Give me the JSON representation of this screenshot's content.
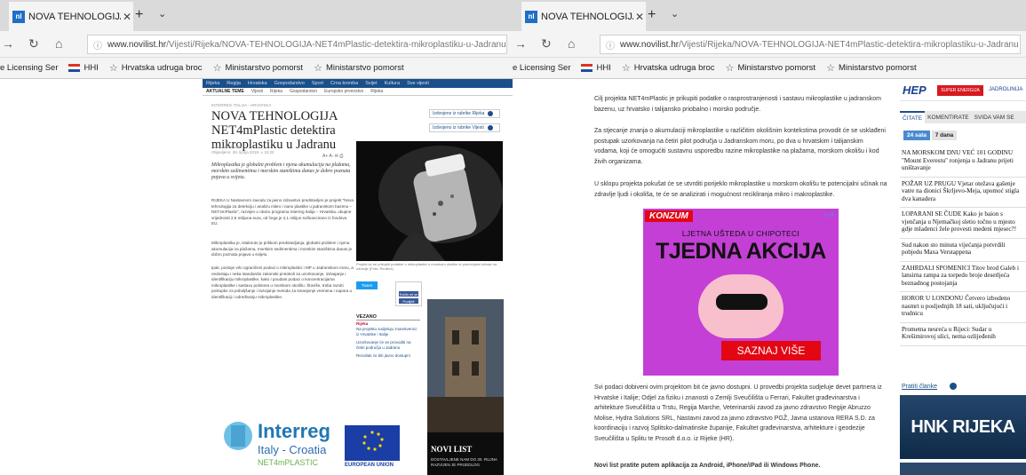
{
  "colors": {
    "brand": "#1b4f8a",
    "ad_bg": "#c43fd6",
    "ad_cta": "#e30613",
    "hep_red": "#d71920"
  },
  "left": {
    "tab_title": "NOVA TEHNOLOGIJA N",
    "url_host": "www.novilist.hr",
    "url_path": "/Vijesti/Rijeka/NOVA-TEHNOLOGIJA-NET4mPlastic-detektira-mikroplastiku-u-Jadranu",
    "bookmarks": [
      "e Licensing Ser",
      "HHI",
      "Hrvatska udruga broc",
      "Ministarstvo pomorst",
      "Ministarstvo pomorst"
    ],
    "page": {
      "nav": [
        "Rijeka",
        "Regija",
        "Hrvatska",
        "Gospodarstvo",
        "Sport",
        "Crna kronika",
        "Svijet",
        "Kultura",
        "Sve vijesti"
      ],
      "subnav_label": "AKTUALNE TEME",
      "subnav": [
        "Vijesti",
        "Rijeka",
        "Gospodarstvo",
        "Europsko prvenstvo",
        "Rijeka"
      ],
      "kicker": "INTERREG ITALIJA - HRVATSKA",
      "title": "NOVA TEHNOLOGIJA NET4mPlastic detektira mikroplastiku u Jadranu",
      "side_link_1": "Izdvojeno iz rubrike Rijeka",
      "side_link_2": "Izdvojeno iz rubrike Vijesti",
      "meta_author": "Autor: NOVI LIST",
      "meta_date": "Objavljeno: 28. lipnja 2018. u 15:22",
      "lead": "Mikroplastika je globalni problem i njena akumulacija na plažama, morskim sedimentima i morskim staništima danas je dobro poznata pojava u svijetu.",
      "body1": "RIJEKA U Nastavnom zavodu za javno zdravstvo predstavljen je projekt \"Nova tehnologija za detekciju i analizu mikro i nano plastike u jadranskom bazenu – NET4mPlastic\", razvijen u okviru programa Interreg Italija – Hrvatska, ukupne vrijednosti 2,5 milijuna eura, od čega je 2,1 milijun sufinancirano iz fondova EU.",
      "body2": "Mikroplastika je, istaknuto je prilikom predstavljanja, globalni problem i njena akumulacija na plažama, morskim sedimentima i morskim staništima danas je dobro poznata pojava u svijetu.",
      "body3": "Ipak, postoje vrlo ograničeni podaci o mikroplastici i MP u Jadranskom moru, a nedostaju i neka standardni zakonski protokoli za uzorkovanje, izdvajanje i identifikaciju mikroplastike, kako i poudani podaci o koncentracijama mikroplastike i sastavu polimera u morskom okolišu. Štoviše, treba razviti postupke za poboljšanje i razvijanje metoda za smanjenje vremena i napora u identifikaciji i određivanju mikroplastike.",
      "caption": "Projekt će se prikupiti podatke o mikroplastici u morskom okolišu te potencijalni učinak na zdravlje (Foto: Reuters)",
      "tweet": "Tweet",
      "like": "Sviđa mi se",
      "share": "Podijeli",
      "related_title": "VEZANO",
      "related_sub": "Rijeka",
      "related": [
        "Na projektu sudjeluju znanstvenici iz Hrvatske i Italije",
        "Uzorkovanje će se provoditi na četiri područja u Jadranu",
        "Rezultati će biti javno dostupni"
      ],
      "interreg_title": "Interreg",
      "interreg_sub": "Italy - Croatia",
      "interreg_proj": "NET4mPLASTIC",
      "eu_label": "EUROPEAN UNION",
      "novilist_title": "NOVI LIST",
      "novilist_desc": "DOSTAVLJENE NAM DO 30. RUJNA RAZVIJEN JE PRIJEDLOG"
    }
  },
  "right": {
    "tab_title": "NOVA TEHNOLOGIJA N",
    "url_host": "www.novilist.hr",
    "url_path": "/Vijesti/Rijeka/NOVA-TEHNOLOGIJA-NET4mPlastic-detektira-mikroplastiku-u-Jadranu",
    "bookmarks": [
      "e Licensing Ser",
      "HHI",
      "Hrvatska udruga broc",
      "Ministarstvo pomorst",
      "Ministarstvo pomorst"
    ],
    "para1": "Cilj projekta NET4mPlastic je prikupiti podatke o rasprostranjenosti i sastavu mikroplastike u jadranskom bazenu, uz hrvatsko i talijansko priobalno i morsko područje.",
    "para2": "Za stjecanje znanja o akumulaciji mikroplastike u različitim okolišnim kontekstima provodit će se usklađeni postupak uzorkovanja na četiri pilot područja u Jadranskom moru, po dva u hrvatskim i talijanskim vodama, koji će omogućiti sustavnu usporedbu razine mikroplastike na plažama, morskom okolišu i kod živih organizama.",
    "para3": "U sklopu projekta pokušat će se utvrditi porijeklo mikroplastike u morskom okolišu te potencijalni učinak na zdravlje ljudi i okoliša, te će se analizirati i mogućnost recikliranja mikro i makroplastike.",
    "para4": "Svi podaci dobiveni ovim projektom bit će javno dostupni. U provedbi projekta sudjeluje devet partnera iz Hrvatske i Italije; Odjel za fiziku i znanosti o Zemlji Sveučilišta u Ferrari, Fakultet građevinarstva i arhitekture Sveučilišta u Trstu, Regija Marche, Veterinarski zavod za javno zdravstvo Regije Abruzzo Molise, Hydra Solutions SRL, Nastavni zavod za javno zdravstvo PGŽ, Javna ustanova RERA S.D. za koordinaciju i razvoj Splitsko-dalmatinske županije, Fakultet građevinarstva, arhitekture i geodezije Sveučilišta u Splitu te Prosoft d.o.o. iz Rijeke (HR).",
    "para5": "Novi list pratite putem aplikacija za Android, iPhone/iPad ili Windows Phone.",
    "ad": {
      "brand": "KONZUM",
      "sub": "LJETNA UŠTEDA U CHIPOTECI",
      "headline": "TJEDNA AKCIJA",
      "cta": "SAZNAJ VIŠE",
      "adchoice": "▷✕"
    },
    "sidebar": {
      "hep": "HEP",
      "hep_badge": "SUPER ENERGIJA",
      "hep_right": "JADROLINIJA",
      "tabs": [
        "ČITATE",
        "KOMENTIRATE",
        "SVIDA VAM SE"
      ],
      "time_24": "24 sata",
      "time_7": "7 dana",
      "items": [
        "NA MORSKOM DNU VEĆ 101 GODINU \"Mount Everestu\" ronjenja u Jadranu prijeti uništavanje",
        "POŽAR UZ PRUGU Vjetar otežava gašenje vatre na dionici Škrljevo-Meja, upomoć stigla dva kanadera",
        "LOPARANI SE ČUDE Kako je baion s vjenčanja u Njemačkoj sletio točno u mjesto gdje mladenci žele provesti medeni mjesec?!",
        "Sud nakon sto minuta vijećanja potvrdili pobjedu Maxa Verstappena",
        "ZAHRDALI SPOMENICI Titov brod Galeb i lansirna rampa za torpedo broje desetljeća beznadnog postojanja",
        "HOROR U LONDONU Četvero izbodeno nasmrt u posljednjih 18 sati, uključujući i trudnicu",
        "Prometna nesreća u Rijeci: Sudar u Krešimirovoj ulici, nema ozlijeđenih"
      ],
      "more": "Pratiti članke",
      "hnk": "HNK RIJEKA"
    }
  }
}
